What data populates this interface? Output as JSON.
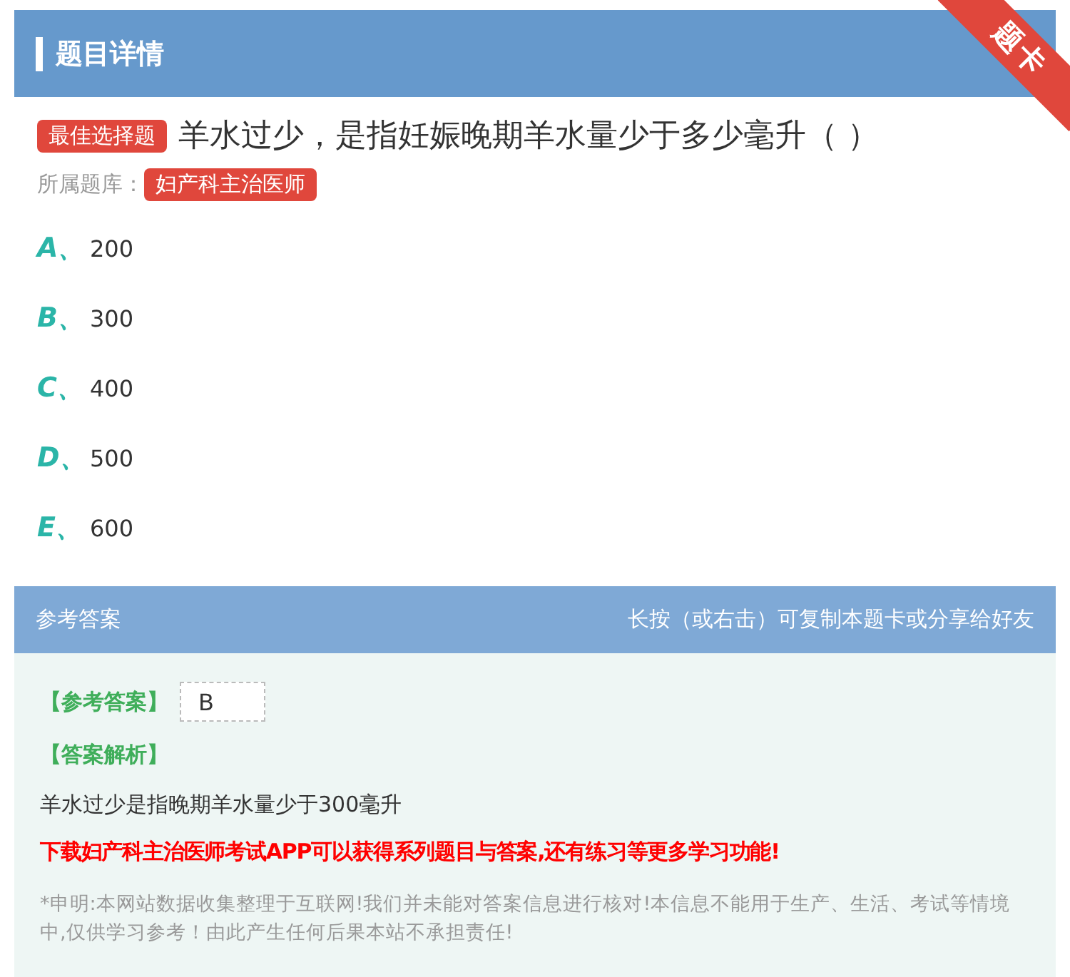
{
  "header": {
    "title": "题目详情",
    "ribbon": "题卡"
  },
  "question": {
    "type_tag": "最佳选择题",
    "text": "羊水过少，是指妊娠晚期羊水量少于多少毫升（ ）",
    "bank_label": "所属题库：",
    "bank_tag": "妇产科主治医师"
  },
  "options": [
    {
      "letter": "A、",
      "text": "200"
    },
    {
      "letter": "B、",
      "text": "300"
    },
    {
      "letter": "C、",
      "text": "400"
    },
    {
      "letter": "D、",
      "text": "500"
    },
    {
      "letter": "E、",
      "text": "600"
    }
  ],
  "answer_section": {
    "title": "参考答案",
    "hint": "长按（或右击）可复制本题卡或分享给好友",
    "answer_label": "【参考答案】",
    "answer": "B",
    "analysis_label": "【答案解析】",
    "analysis": "羊水过少是指晚期羊水量少于300毫升",
    "promo": "下载妇产科主治医师考试APP可以获得系列题目与答案,还有练习等更多学习功能!",
    "disclaimer": "*申明:本网站数据收集整理于互联网!我们并未能对答案信息进行核对!本信息不能用于生产、生活、考试等情境中,仅供学习参考！由此产生任何后果本站不承担责任!"
  }
}
